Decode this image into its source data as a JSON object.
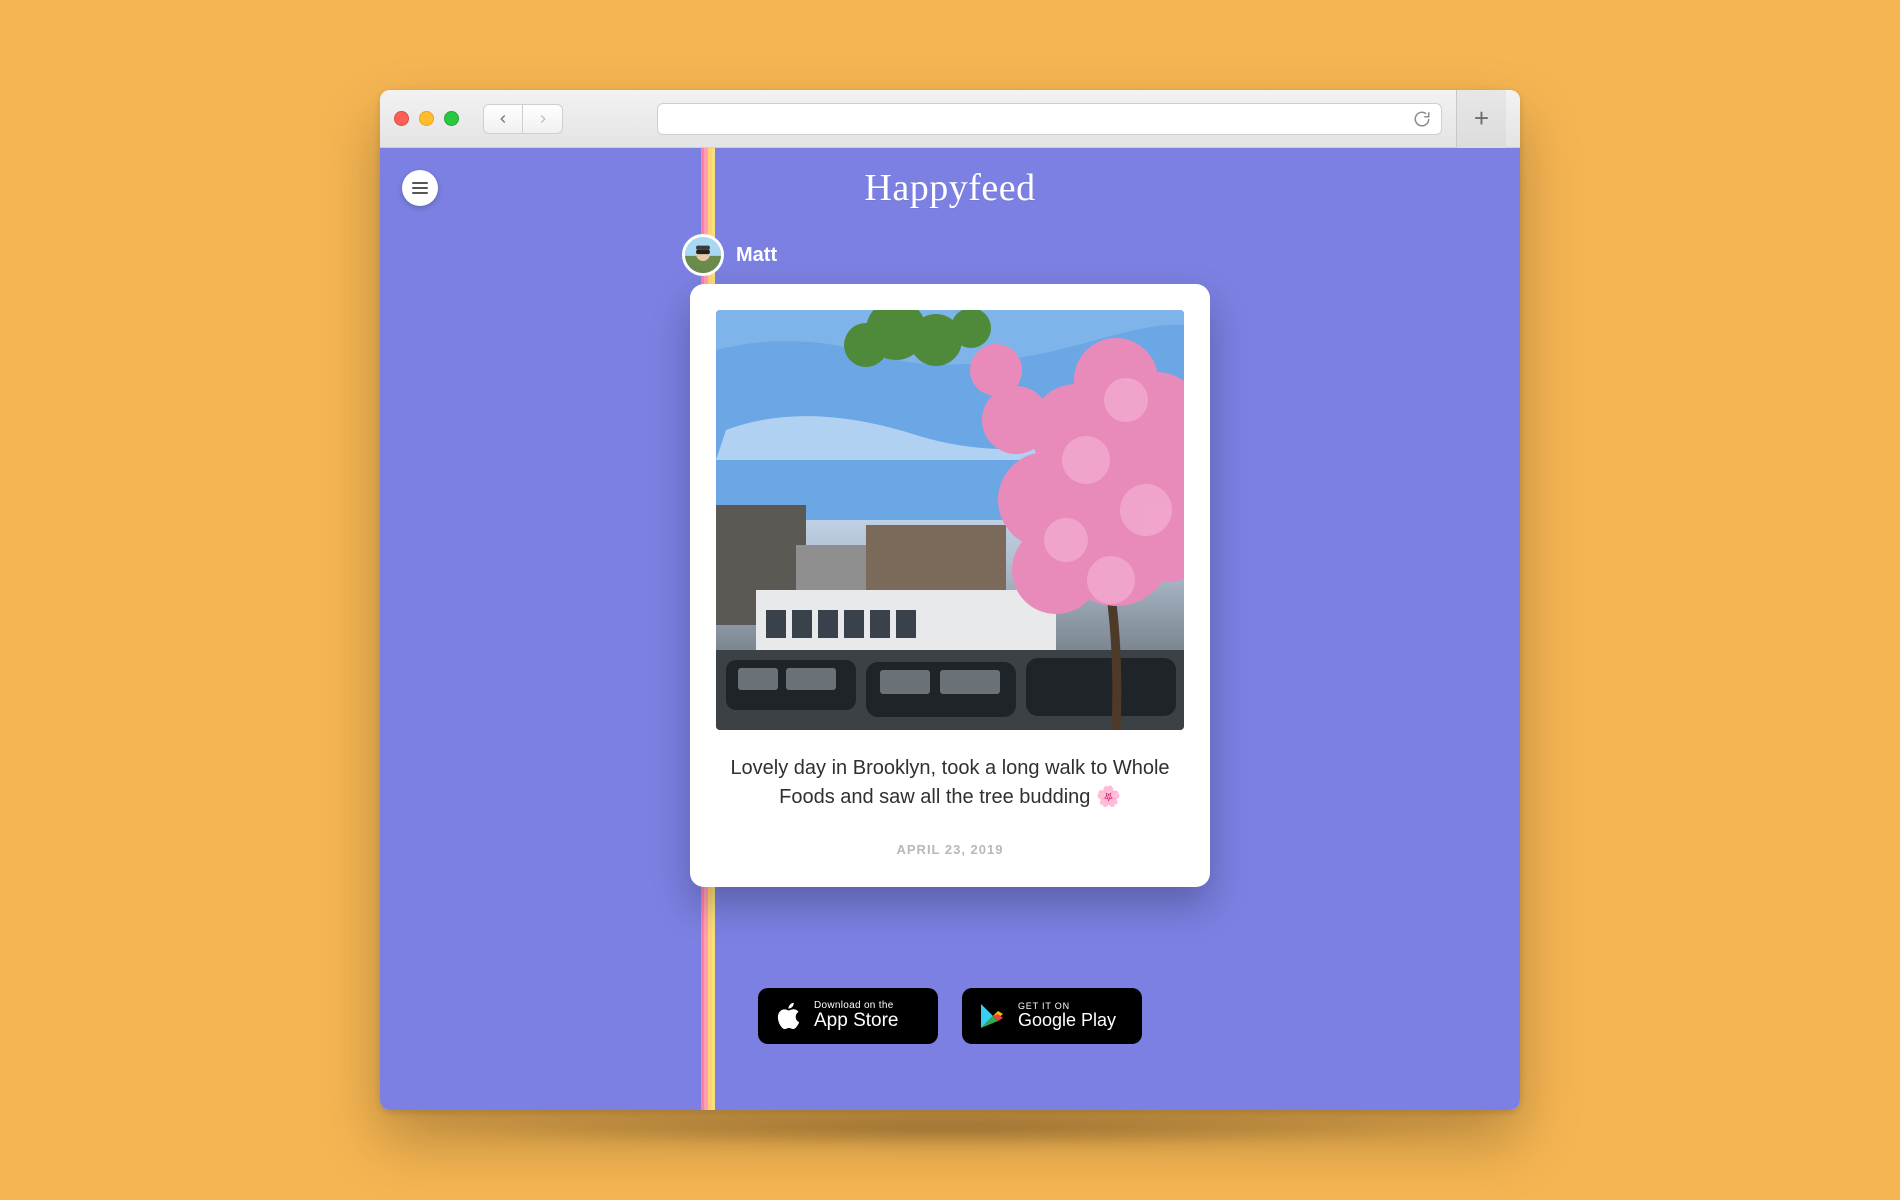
{
  "chrome": {
    "back_disabled": false,
    "forward_disabled": true,
    "url_value": ""
  },
  "app": {
    "logo_text": "Happyfeed",
    "menu_label": "Menu"
  },
  "profile": {
    "username": "Matt"
  },
  "post": {
    "caption": "Lovely day in Brooklyn, took a long walk to Whole Foods and saw all the tree budding 🌸",
    "date": "APRIL 23, 2019",
    "image_alt": "Pink cherry-blossom tree on a Brooklyn street with parked cars and brownstones"
  },
  "stores": {
    "apple": {
      "small": "Download on the",
      "big": "App Store"
    },
    "google": {
      "small": "GET IT ON",
      "big": "Google Play"
    }
  },
  "colors": {
    "page_bg": "#7b80e2",
    "outer_bg": "#f5b552"
  }
}
